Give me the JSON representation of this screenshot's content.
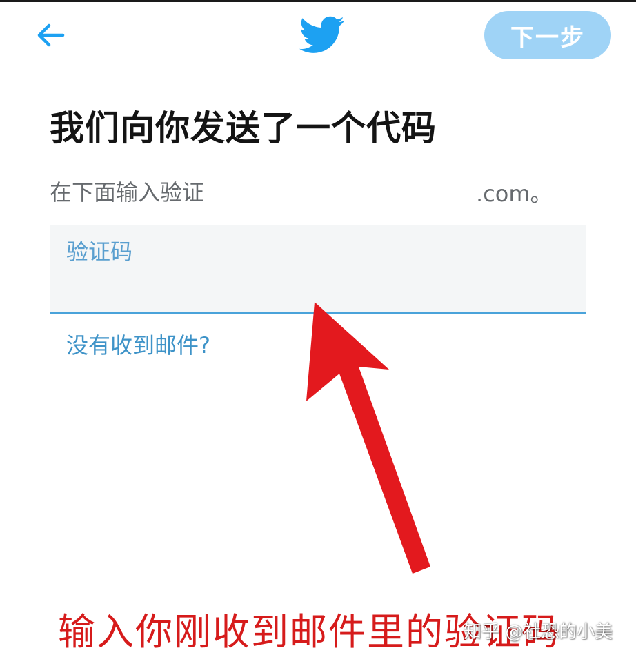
{
  "header": {
    "back_icon": "arrow-left-icon",
    "logo_icon": "twitter-bird-icon",
    "next_label": "下一步"
  },
  "main": {
    "title": "我们向你发送了一个代码",
    "subtitle": "在下面输入验证",
    "subtitle_suffix": ".com。",
    "code_field": {
      "label": "验证码",
      "value": ""
    },
    "resend_link": "没有收到邮件?"
  },
  "annotation": {
    "caption": "输入你刚收到邮件里的验证码",
    "watermark": "知乎 @社恐的小美"
  },
  "colors": {
    "brand_blue": "#1da1f2",
    "next_button_bg": "#9fd3f6",
    "field_underline": "#4aa3da",
    "arrow_red": "#e3191e",
    "caption_red": "#d61b1b"
  }
}
